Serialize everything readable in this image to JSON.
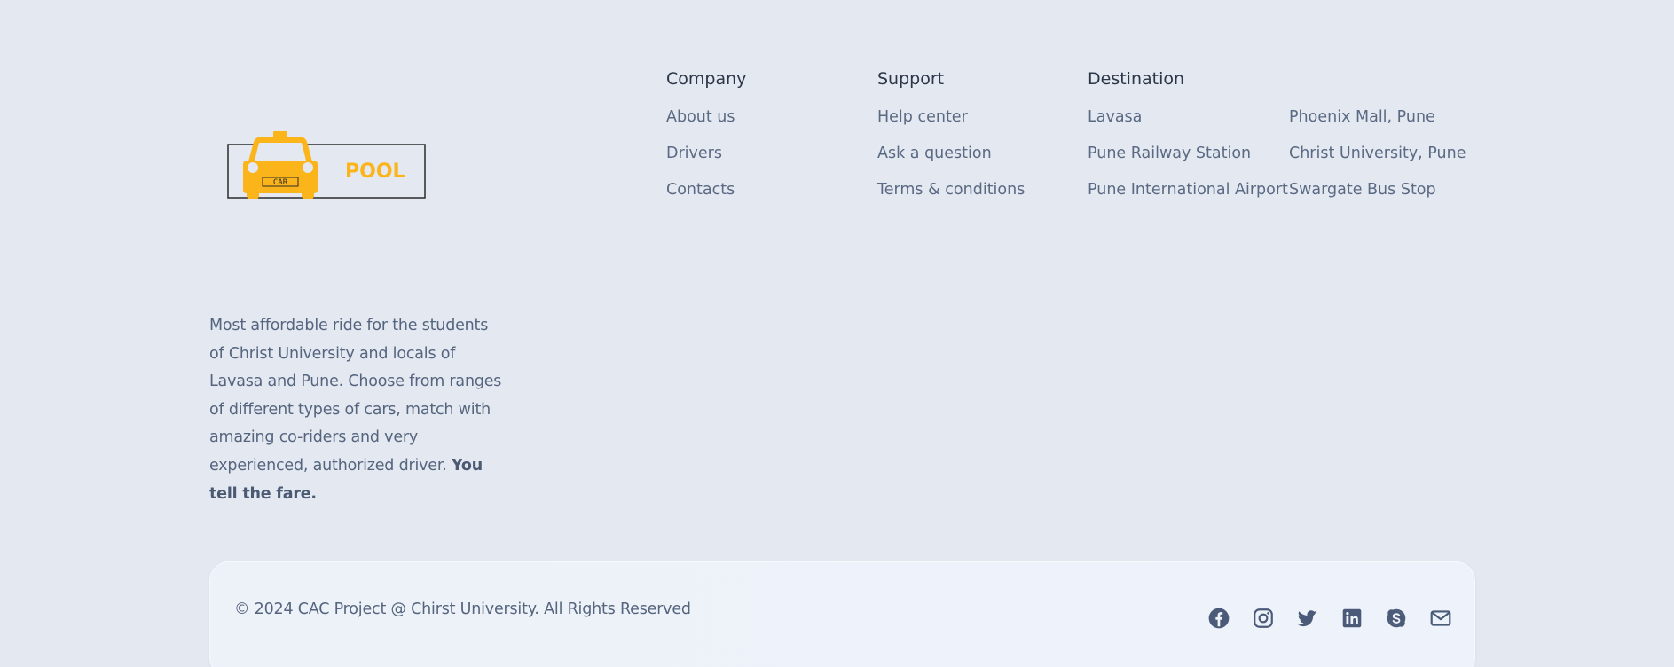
{
  "logo": {
    "badge_text": "CAR",
    "brand_text": "POOL",
    "color": "#fbb41a"
  },
  "about": {
    "text": "Most affordable ride for the students of Christ University and locals of Lavasa and Pune. Choose from ranges of different types of cars, match with amazing co-riders and very experienced, authorized driver. ",
    "emphasis": "You tell the fare."
  },
  "company": {
    "heading": "Company",
    "links": [
      "About us",
      "Drivers",
      "Contacts"
    ]
  },
  "support": {
    "heading": "Support",
    "links": [
      "Help center",
      "Ask a question",
      "Terms & conditions"
    ]
  },
  "destination": {
    "heading": "Destination",
    "links": [
      "Lavasa",
      "Pune Railway Station",
      "Pune International Airport"
    ],
    "links_2": [
      "Phoenix Mall, Pune",
      "Christ University, Pune",
      "Swargate Bus Stop"
    ]
  },
  "footer": {
    "copyright": "© 2024 CAC Project @ Chirst University. All Rights Reserved",
    "social_icons": [
      "facebook-icon",
      "instagram-icon",
      "twitter-icon",
      "linkedin-icon",
      "skype-icon",
      "mail-icon"
    ],
    "icon_color": "#4a5a78"
  }
}
